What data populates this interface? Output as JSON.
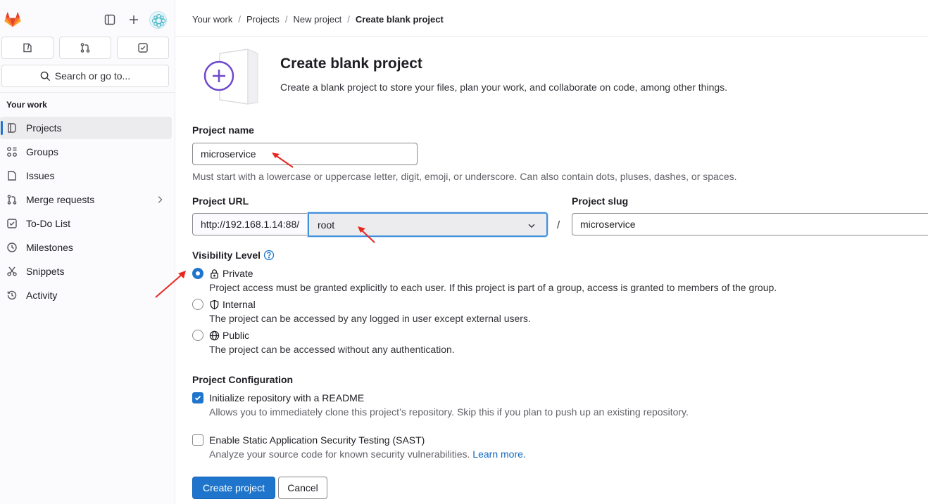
{
  "sidebar": {
    "search_label": "Search or go to...",
    "section_title": "Your work",
    "items": [
      {
        "label": "Projects",
        "icon": "project-icon",
        "active": true
      },
      {
        "label": "Groups",
        "icon": "group-icon"
      },
      {
        "label": "Issues",
        "icon": "issues-icon"
      },
      {
        "label": "Merge requests",
        "icon": "merge-request-icon"
      },
      {
        "label": "To-Do List",
        "icon": "todo-icon"
      },
      {
        "label": "Milestones",
        "icon": "milestone-icon"
      },
      {
        "label": "Snippets",
        "icon": "snippet-icon"
      },
      {
        "label": "Activity",
        "icon": "history-icon"
      }
    ]
  },
  "breadcrumb": [
    "Your work",
    "Projects",
    "New project",
    "Create blank project"
  ],
  "header": {
    "title": "Create blank project",
    "description": "Create a blank project to store your files, plan your work, and collaborate on code, among other things."
  },
  "form": {
    "project_name_label": "Project name",
    "project_name_value": "microservice",
    "project_name_help": "Must start with a lowercase or uppercase letter, digit, emoji, or underscore. Can also contain dots, pluses, dashes, or spaces.",
    "project_url_label": "Project URL",
    "url_prefix": "http://192.168.1.14:88/",
    "namespace": "root",
    "slash": "/",
    "project_slug_label": "Project slug",
    "project_slug_value": "microservice",
    "visibility_label": "Visibility Level",
    "visibility": [
      {
        "label": "Private",
        "desc": "Project access must be granted explicitly to each user. If this project is part of a group, access is granted to members of the group.",
        "checked": true
      },
      {
        "label": "Internal",
        "desc": "The project can be accessed by any logged in user except external users."
      },
      {
        "label": "Public",
        "desc": "The project can be accessed without any authentication."
      }
    ],
    "config_label": "Project Configuration",
    "readme_label": "Initialize repository with a README",
    "readme_desc": "Allows you to immediately clone this project’s repository. Skip this if you plan to push up an existing repository.",
    "sast_label": "Enable Static Application Security Testing (SAST)",
    "sast_desc": "Analyze your source code for known security vulnerabilities.",
    "learn_more": "Learn more.",
    "create_button": "Create project",
    "cancel_button": "Cancel"
  },
  "colors": {
    "accent": "#1f75cb",
    "annotation_arrow": "#e8271f"
  }
}
